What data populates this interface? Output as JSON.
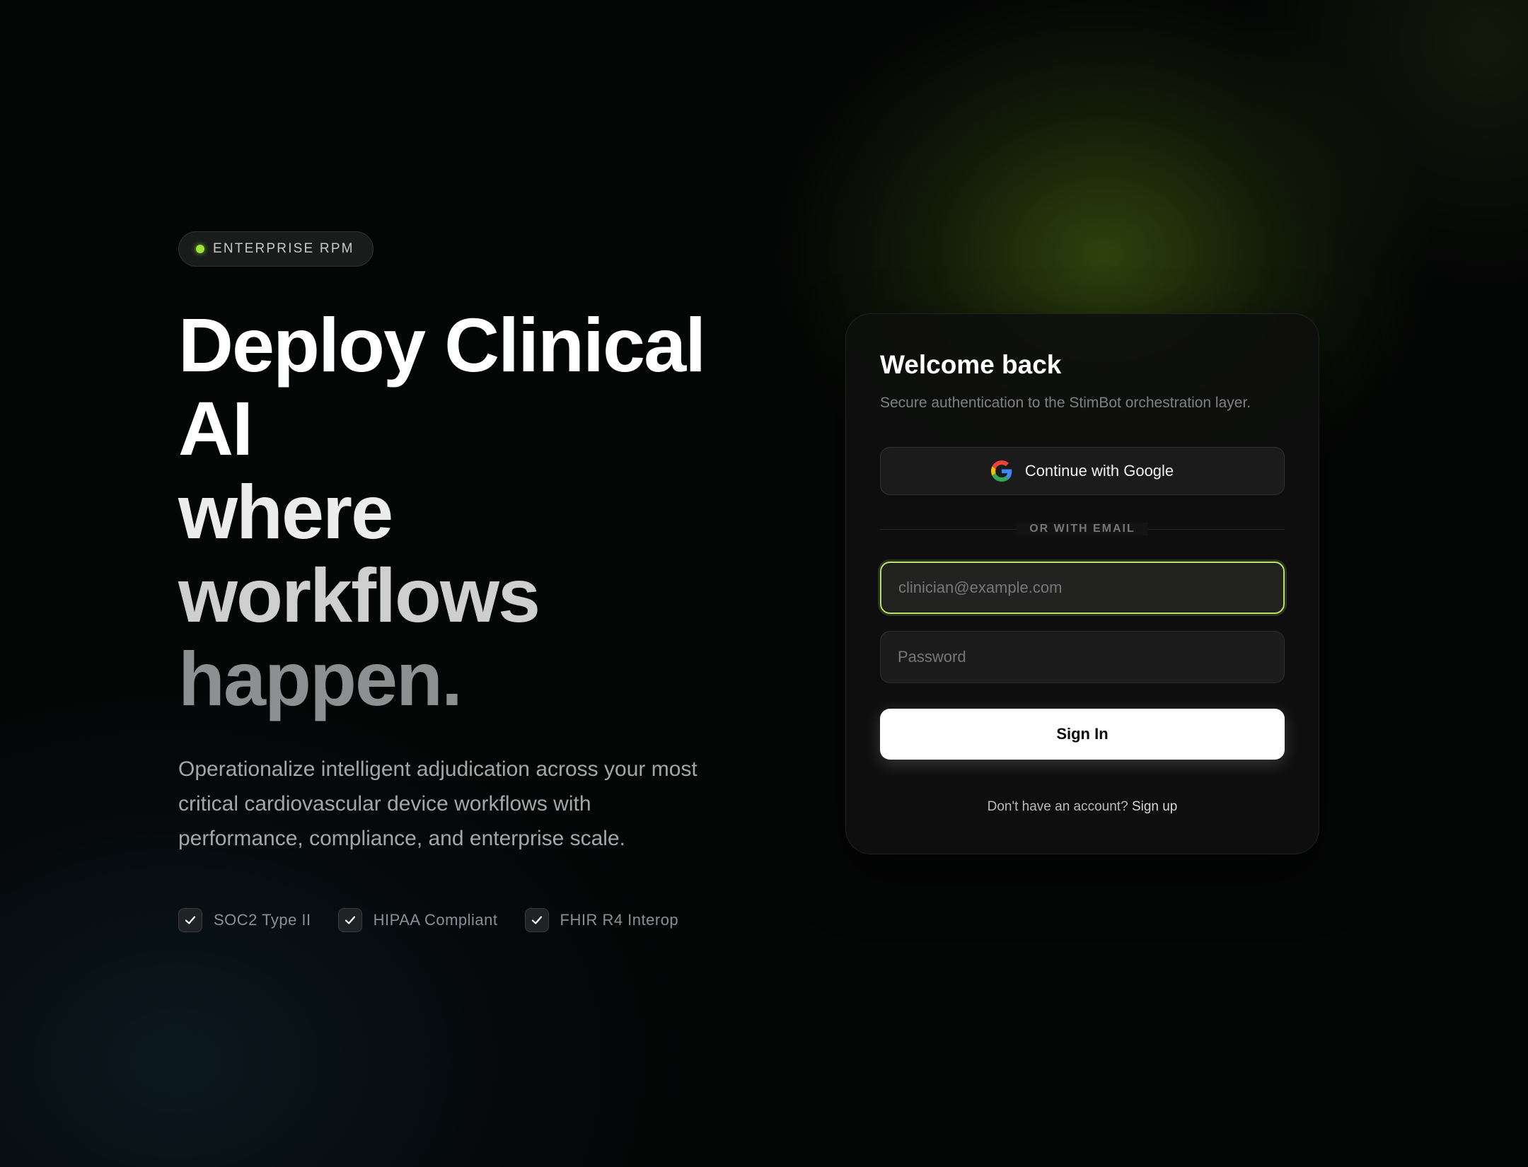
{
  "hero": {
    "pill_label": "ENTERPRISE RPM",
    "headline_lines": [
      "Deploy Clinical",
      "AI",
      "where",
      "workflows",
      "happen."
    ],
    "subtext": "Operationalize intelligent adjudication across your most critical cardiovascular device workflows with performance, compliance, and enterprise scale.",
    "badges": [
      {
        "label": "SOC2 Type II",
        "icon": "check-icon"
      },
      {
        "label": "HIPAA Compliant",
        "icon": "check-icon"
      },
      {
        "label": "FHIR R4 Interop",
        "icon": "check-icon"
      }
    ]
  },
  "login": {
    "title": "Welcome back",
    "subtitle": "Secure authentication to the StimBot orchestration layer.",
    "google_button": "Continue with Google",
    "divider_label": "OR WITH EMAIL",
    "email_placeholder": "clinician@example.com",
    "email_value": "",
    "password_placeholder": "Password",
    "password_value": "",
    "signin_button": "Sign In",
    "signup_prompt": "Don't have an account?",
    "signup_link": "Sign up"
  },
  "colors": {
    "accent": "#9ee43a",
    "focus_ring": "#b7e36a",
    "background": "#040505",
    "card": "#0e0f0e"
  }
}
